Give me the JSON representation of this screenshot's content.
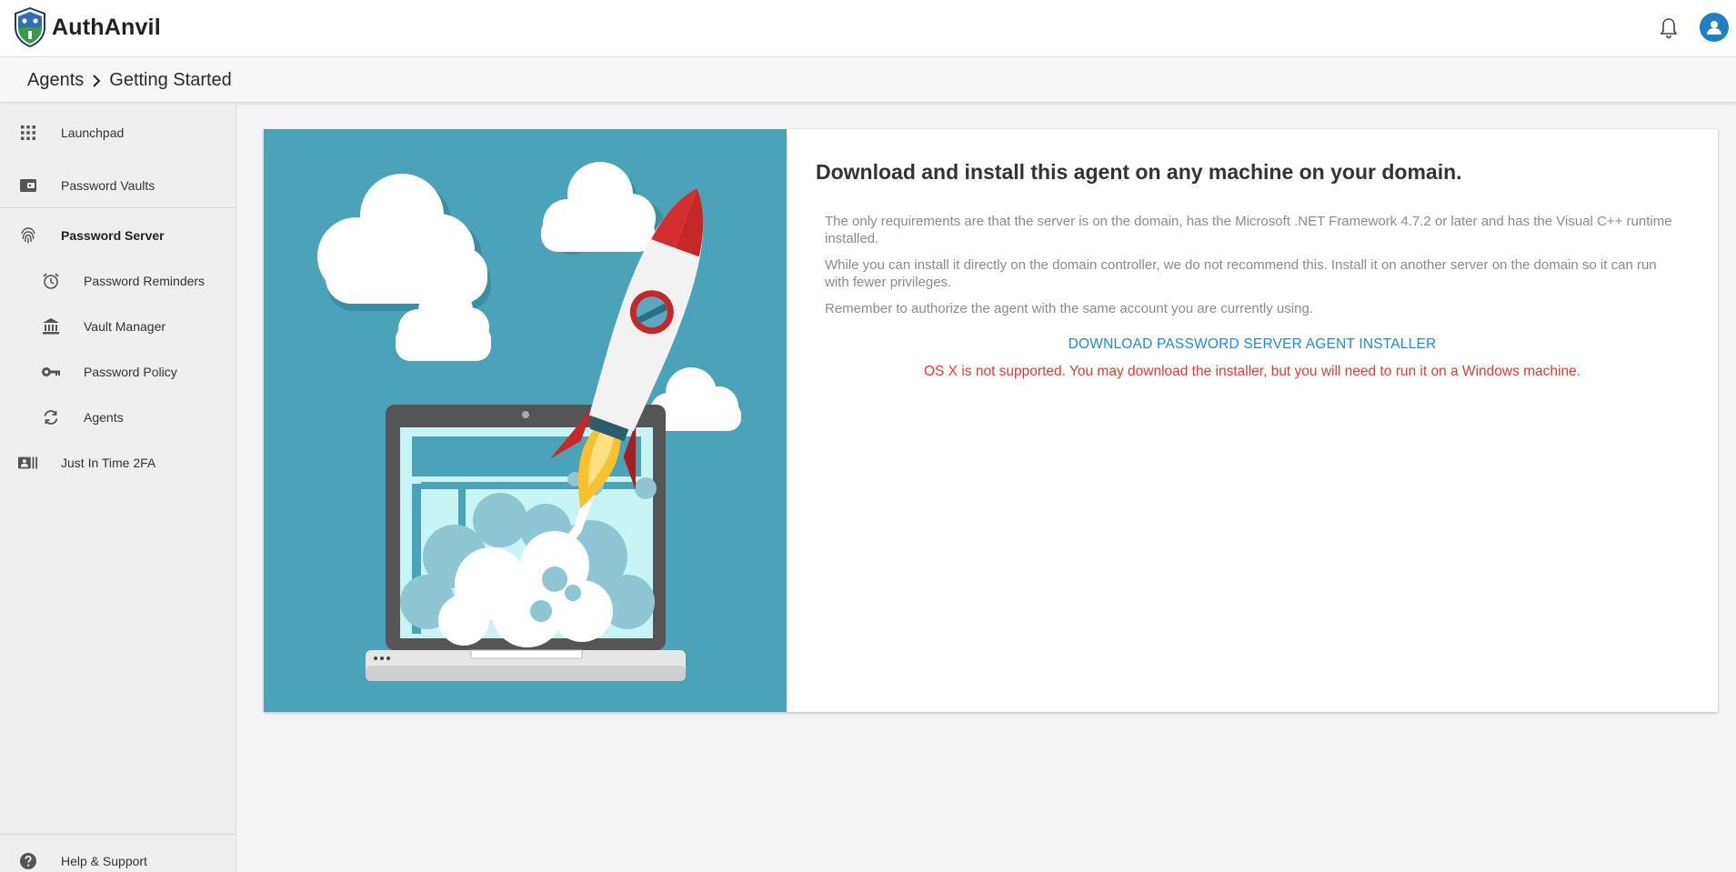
{
  "app": {
    "name": "AuthAnvil"
  },
  "breadcrumb": {
    "items": [
      "Agents",
      "Getting Started"
    ]
  },
  "sidebar": {
    "items": [
      {
        "label": "Launchpad"
      },
      {
        "label": "Password Vaults"
      },
      {
        "label": "Password Server"
      },
      {
        "label": "Password Reminders"
      },
      {
        "label": "Vault Manager"
      },
      {
        "label": "Password Policy"
      },
      {
        "label": "Agents"
      },
      {
        "label": "Just In Time 2FA"
      }
    ],
    "footer_label": "Help & Support"
  },
  "main": {
    "headline": "Download and install this agent on any machine on your domain.",
    "paragraphs": [
      "The only requirements are that the server is on the domain, has the Microsoft .NET Framework 4.7.2 or later and has the Visual C++ runtime installed.",
      "While you can install it directly on the domain controller, we do not recommend this. Install it on another server on the domain so it can run with fewer privileges.",
      "Remember to authorize the agent with the same account you are currently using."
    ],
    "download_label": "DOWNLOAD PASSWORD SERVER AGENT INSTALLER",
    "warning": "OS X is not supported. You may download the installer, but you will need to run it on a Windows machine."
  },
  "colors": {
    "accent": "#1e88e5",
    "warning": "#e53935",
    "hero_bg": "#4aa3b8",
    "avatar_bg": "#1f7fc6"
  },
  "icons": {
    "logo": "authanvil-shield-icon",
    "notifications": "bell-icon",
    "account": "user-avatar-icon",
    "launchpad": "grid-icon",
    "password_vaults": "wallet-icon",
    "password_server": "fingerprint-icon",
    "password_reminders": "alarm-clock-icon",
    "vault_manager": "bank-icon",
    "password_policy": "key-icon",
    "agents": "sync-icon",
    "just_in_time_2fa": "id-card-icon",
    "help": "help-circle-icon"
  }
}
